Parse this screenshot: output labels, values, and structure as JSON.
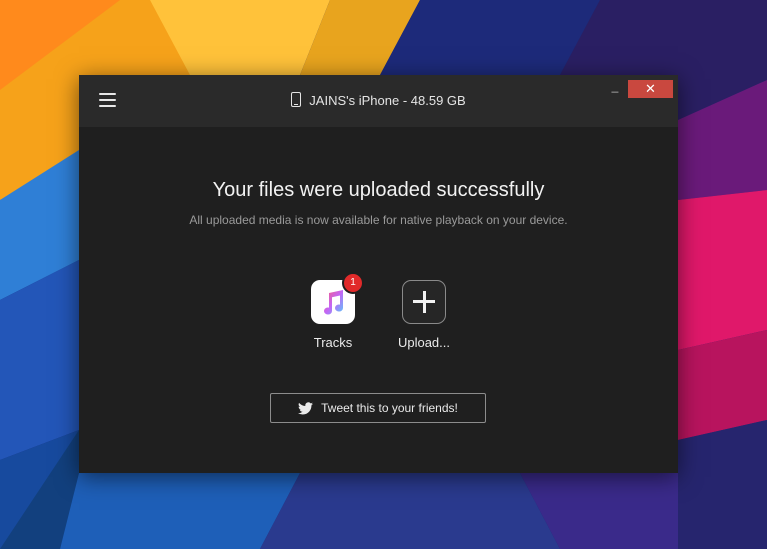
{
  "window": {
    "device_title": "JAINS's iPhone - 48.59 GB",
    "minimize_glyph": "_",
    "close_glyph": "✕"
  },
  "main": {
    "headline": "Your files were uploaded successfully",
    "subline": "All uploaded media is now available for native playback on your device.",
    "tiles": [
      {
        "label": "Tracks",
        "icon": "music-app-icon",
        "badge": "1"
      },
      {
        "label": "Upload...",
        "icon": "plus-icon"
      }
    ],
    "tweet_label": "Tweet this to your friends!"
  },
  "colors": {
    "window_bg": "#1f1f1f",
    "titlebar_bg": "#2a2a2a",
    "close_button": "#c9483f",
    "badge": "#e12a2a"
  }
}
